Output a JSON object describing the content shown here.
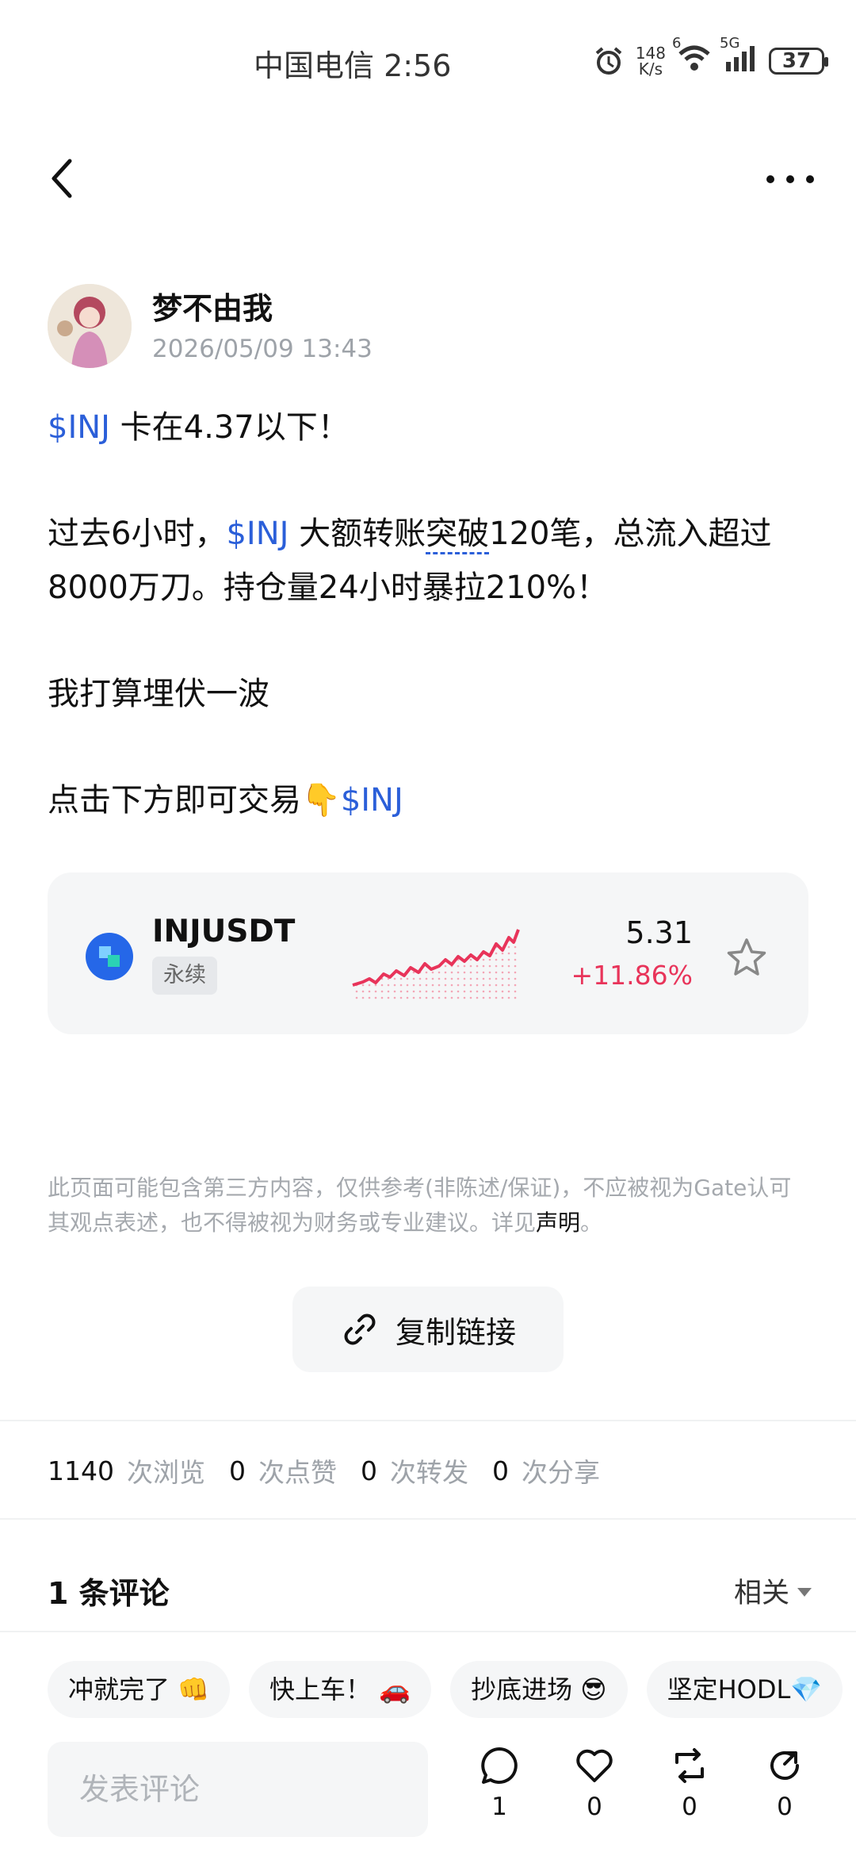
{
  "status_bar": {
    "carrier_time": "中国电信 2:56",
    "speed_value": "148",
    "speed_unit": "K/s",
    "wifi_label": "6",
    "signal_label": "5G",
    "battery": "37"
  },
  "author": {
    "name": "梦不由我",
    "date": "2026/05/09 13:43"
  },
  "post": {
    "tag": "$INJ",
    "line1": " 卡在4.37以下！",
    "line2_a": "过去6小时，",
    "line2_b": " 大额转账",
    "line2_c": "突破",
    "line2_d": "120笔，总流入超过8000万刀。持仓量24小时暴拉210%！",
    "line3": "我打算埋伏一波",
    "line4": "点击下方即可交易",
    "line4_emoji": "👇"
  },
  "ticker": {
    "symbol": "INJUSDT",
    "type": "永续",
    "price": "5.31",
    "change": "+11.86%",
    "colors": {
      "up": "#e8345a",
      "coin": "#2567e8"
    }
  },
  "disclaimer": {
    "text": "此页面可能包含第三方内容，仅供参考(非陈述/保证)，不应被视为Gate认可其观点表述，也不得被视为财务或专业建议。详见",
    "link": "声明",
    "end": "。"
  },
  "copy_link": {
    "label": "复制链接"
  },
  "stats": {
    "views_num": "1140",
    "views_label": "次浏览",
    "likes_num": "0",
    "likes_label": "次点赞",
    "reposts_num": "0",
    "reposts_label": "次转发",
    "shares_num": "0",
    "shares_label": "次分享"
  },
  "comments": {
    "title": "1 条评论",
    "sort_label": "相关"
  },
  "chips": [
    "冲就完了 👊",
    "快上车！ 🚗",
    "抄底进场 😎",
    "坚定HODL💎"
  ],
  "bottom_bar": {
    "input_placeholder": "发表评论",
    "comment_count": "1",
    "like_count": "0",
    "repost_count": "0",
    "share_count": "0"
  }
}
